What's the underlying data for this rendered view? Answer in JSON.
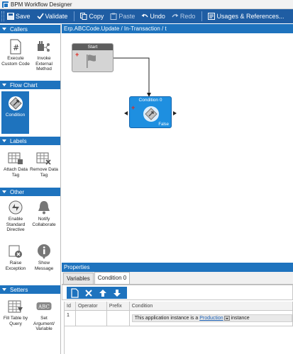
{
  "window": {
    "title": "BPM Workflow Designer"
  },
  "toolbar": {
    "save": "Save",
    "validate": "Validate",
    "copy": "Copy",
    "paste": "Paste",
    "undo": "Undo",
    "redo": "Redo",
    "usages": "Usages & References..."
  },
  "categories": [
    {
      "label": "Callers",
      "items": [
        "Execute Custom Code",
        "Invoke External Method"
      ]
    },
    {
      "label": "Flow Chart",
      "items": [
        "Condition"
      ]
    },
    {
      "label": "Labels",
      "items": [
        "Attach Data Tag",
        "Remove Data Tag"
      ]
    },
    {
      "label": "Other",
      "items": [
        "Enable Standard Directive",
        "Notify Collaborate",
        "Raise Exception",
        "Show Message"
      ]
    },
    {
      "label": "Setters",
      "items": [
        "Fill Table by Query",
        "Set Argument/ Variable"
      ]
    }
  ],
  "canvas": {
    "breadcrumb": "Erp.ABCCode.Update / In-Transaction / t",
    "start_node": "Start",
    "condition_node": "Condition 0",
    "false_label": "False",
    "abc_icon_text": "ABC"
  },
  "properties": {
    "title": "Properties",
    "tabs": [
      "Variables",
      "Condition 0"
    ],
    "columns": [
      "Id",
      "Operator",
      "Prefix",
      "Condition"
    ],
    "rows": [
      {
        "id": "1",
        "operator": "",
        "prefix": "",
        "condition_prefix": "This application instance is a",
        "condition_link": "Production",
        "condition_suffix": "instance"
      }
    ]
  },
  "colors": {
    "accent": "#1e73be",
    "toolbar": "#1f5da3",
    "node_condition": "#1e8fe0",
    "node_start": "#d4d4d4"
  }
}
